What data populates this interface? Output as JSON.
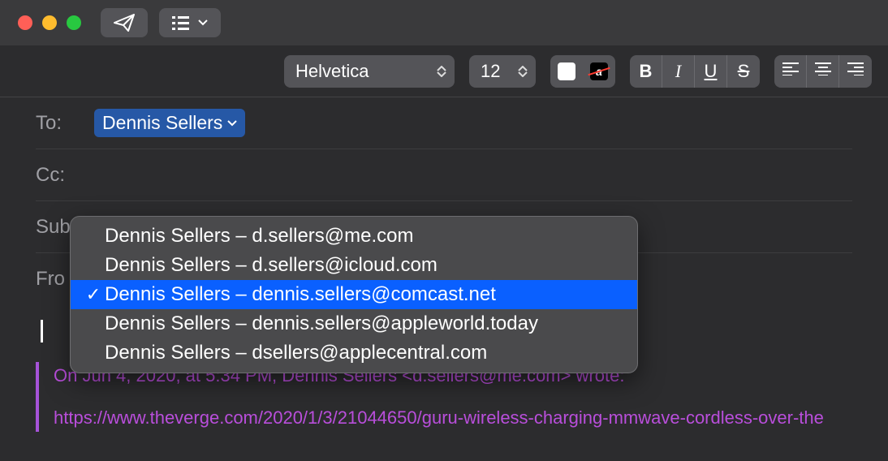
{
  "toolbar": {
    "font_family": "Helvetica",
    "font_size": "12",
    "bold": "B",
    "italic": "I",
    "underline": "U",
    "strike": "S"
  },
  "fields": {
    "to_label": "To:",
    "to_recipient": "Dennis Sellers",
    "cc_label": "Cc:",
    "subject_label": "Sub",
    "from_label": "Fro"
  },
  "from_dropdown": {
    "items": [
      {
        "label": "Dennis Sellers – d.sellers@me.com",
        "selected": false
      },
      {
        "label": "Dennis Sellers – d.sellers@icloud.com",
        "selected": false
      },
      {
        "label": "Dennis Sellers – dennis.sellers@comcast.net",
        "selected": true
      },
      {
        "label": "Dennis Sellers – dennis.sellers@appleworld.today",
        "selected": false
      },
      {
        "label": "Dennis Sellers – dsellers@applecentral.com",
        "selected": false
      }
    ]
  },
  "body": {
    "quote_header": "On Jun 4, 2020, at 5:34 PM, Dennis Sellers <d.sellers@me.com> wrote:",
    "quote_link": "https://www.theverge.com/2020/1/3/21044650/guru-wireless-charging-mmwave-cordless-over-the"
  }
}
